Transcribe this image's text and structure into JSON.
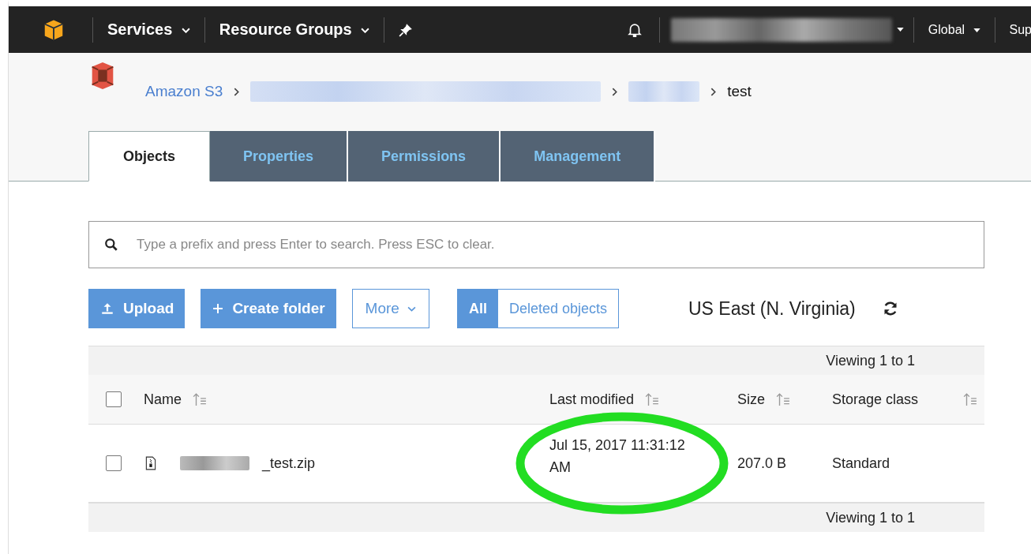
{
  "top_nav": {
    "items": [
      {
        "label": "Services"
      },
      {
        "label": "Resource Groups"
      }
    ],
    "region": "Global",
    "support": "Sup"
  },
  "breadcrumb": {
    "root": "Amazon S3",
    "current": "test"
  },
  "tabs": [
    {
      "label": "Objects",
      "selected": true
    },
    {
      "label": "Properties",
      "selected": false
    },
    {
      "label": "Permissions",
      "selected": false
    },
    {
      "label": "Management",
      "selected": false
    }
  ],
  "search": {
    "placeholder": "Type a prefix and press Enter to search. Press ESC to clear."
  },
  "actions": {
    "upload": "Upload",
    "create_folder": "Create folder",
    "more": "More"
  },
  "view_toggle": [
    {
      "label": "All",
      "selected": true
    },
    {
      "label": "Deleted objects",
      "selected": false
    }
  ],
  "region_label": "US East (N. Virginia)",
  "pager_top": "Viewing 1 to 1",
  "table": {
    "select_all_checked": false,
    "columns": [
      "Name",
      "Last modified",
      "Size",
      "Storage class"
    ],
    "rows": [
      {
        "checked": false,
        "name": "_test.zip",
        "last_modified": "Jul 15, 2017 11:31:12 AM",
        "size": "207.0 B",
        "storage_class": "Standard"
      }
    ]
  },
  "pager_bottom": "Viewing 1 to 1"
}
